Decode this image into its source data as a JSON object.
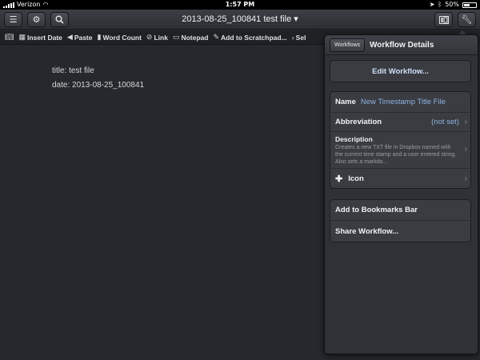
{
  "status": {
    "carrier": "Verizon",
    "time": "1:57 PM",
    "battery": "50%"
  },
  "titlebar": {
    "doc_title": "2013-08-25_100841 test file ▾"
  },
  "toolbar": {
    "items": [
      {
        "icon": "book-icon",
        "label": ""
      },
      {
        "icon": "calendar-icon",
        "label": "Insert Date"
      },
      {
        "icon": "paste-icon",
        "label": "Paste"
      },
      {
        "icon": "bar-chart-icon",
        "label": "Word Count"
      },
      {
        "icon": "link-icon",
        "label": "Link"
      },
      {
        "icon": "notepad-icon",
        "label": "Notepad"
      },
      {
        "icon": "edit-icon",
        "label": "Add to Scratchpad..."
      },
      {
        "icon": "chevron-right-icon",
        "label": "Sel"
      }
    ]
  },
  "editor": {
    "lines": [
      "title: test file",
      "date: 2013-08-25_100841"
    ]
  },
  "popover": {
    "back_label": "Workflows",
    "title": "Workflow Details",
    "edit_label": "Edit Workflow...",
    "name_label": "Name",
    "name_value": "New Timestamp Title File",
    "abbrev_label": "Abbreviation",
    "abbrev_value": "(not set)",
    "desc_label": "Description",
    "desc_text": "Creates a new TXT file in Dropbox named with the current time stamp and a user entered string. Also sets a markdo...",
    "icon_label": "Icon",
    "bookmarks_label": "Add to Bookmarks Bar",
    "share_label": "Share Workflow..."
  },
  "colors": {
    "background": "#26282d",
    "accent_blue": "#8fb3e0"
  }
}
